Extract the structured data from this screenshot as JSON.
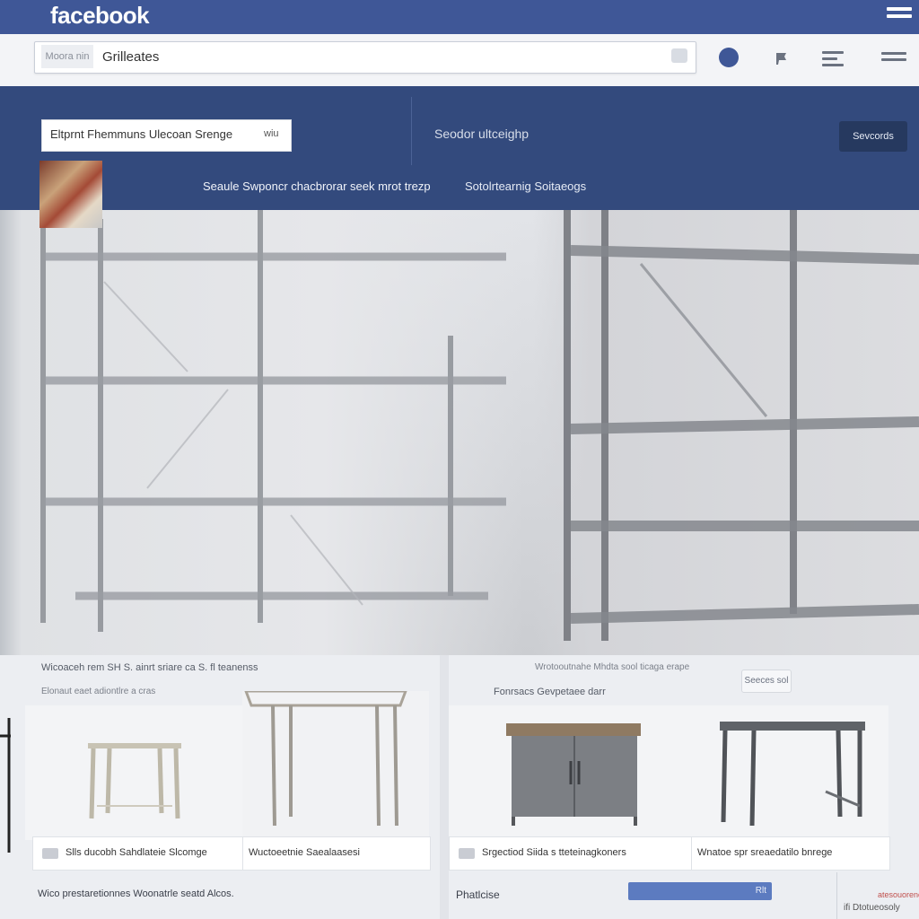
{
  "header": {
    "logo": "facebook",
    "search_scope": "Moora nin",
    "search_query": "Grilleates"
  },
  "banner": {
    "filter_label": "Eltprnt Fhemmuns Ulecoan Srenge",
    "filter_tag": "wiu",
    "search_text": "Seodor ultceighp",
    "button_label": "Sevcords",
    "subtitle_left": "Seaule Swponcr  chacbrorar  seek mrot trezp",
    "subtitle_right": "Sotolrtearnig Soitaeogs"
  },
  "listing": {
    "left_heading": "Wicoaceh rem SH S. ainrt sriare ca S. fl teanenss",
    "left_subheading": "Elonaut eaet adiontlre a cras",
    "right_heading": "Wrotooutnahe Mhdta sool ticaga erape",
    "right_subheading": "Fonrsacs Gevpetaee darr",
    "right_badge": "Seeces sol",
    "cards": [
      {
        "caption": "Slls ducobh Sahdlateie Slcomge"
      },
      {
        "caption": "Wuctoeetnie Saealaasesi"
      },
      {
        "caption": "Srgectiod Siida s tteteinagkoners"
      },
      {
        "caption": "Wnatoe spr sreaedatilo bnrege"
      }
    ]
  },
  "footer": {
    "left_text": "Wico prestaretionnes Woonatrle seatd Alcos.",
    "mid_label": "Phatlcise",
    "bar_label": "Rlt",
    "right_red": "atesouorene",
    "right_text": "ifi Dtotueosoly"
  },
  "colors": {
    "brand_blue": "#3f5797",
    "banner_blue": "#334a7d",
    "button_dark": "#26395f"
  }
}
